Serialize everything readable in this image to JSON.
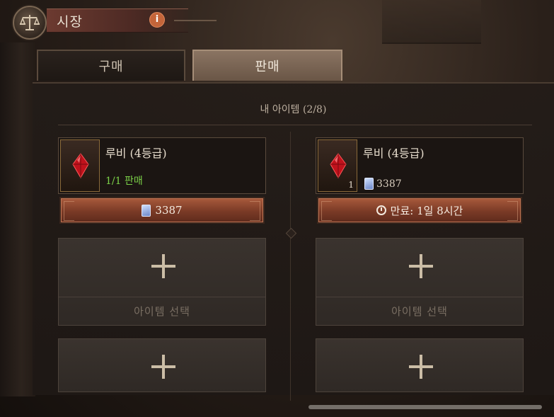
{
  "header": {
    "title": "시장",
    "info_icon": "info-icon"
  },
  "tabs": [
    {
      "label": "구매",
      "active": false
    },
    {
      "label": "판매",
      "active": true
    }
  ],
  "panel": {
    "title": "내 아이템 (2/8)"
  },
  "listings": [
    {
      "name": "루비 (4등급)",
      "icon": "ruby-gem-icon",
      "status": "1/1 판매",
      "quantity": "",
      "price": "",
      "bar_text": "3387",
      "bar_icon": "crystal-currency-icon"
    },
    {
      "name": "루비 (4등급)",
      "icon": "ruby-gem-icon",
      "status": "",
      "quantity": "1",
      "price": "3387",
      "bar_text": "만료: 1일 8시간",
      "bar_icon": "clock-icon"
    }
  ],
  "empty_slot_label": "아이템 선택",
  "colors": {
    "sale_status": "#7bd048",
    "bar_red": "#8a4028",
    "active_tab": "#7a6452"
  }
}
